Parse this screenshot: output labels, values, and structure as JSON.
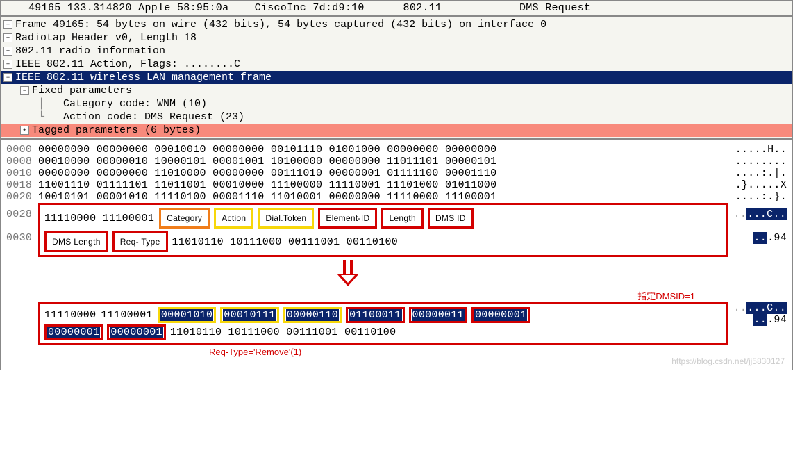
{
  "packet_list": {
    "no": "49165",
    "time": "133.314820",
    "source": "Apple 58:95:0a",
    "dest": "CiscoInc 7d:d9:10",
    "proto": "802.11",
    "info": "DMS Request"
  },
  "tree": {
    "frame": "Frame 49165: 54 bytes on wire (432 bits), 54 bytes captured (432 bits) on interface 0",
    "radiotap": "Radiotap Header v0, Length 18",
    "radio_info": "802.11 radio information",
    "ieee_action": "IEEE 802.11 Action, Flags: ........C",
    "wlan_mgmt": "IEEE 802.11 wireless LAN management frame",
    "fixed_params": "Fixed parameters",
    "category": "Category code: WNM (10)",
    "action": "Action code: DMS Request (23)",
    "tagged": "Tagged parameters (6 bytes)"
  },
  "hex": {
    "rows": [
      {
        "offset": "0000",
        "bytes": "00000000 00000000 00010010 00000000 00101110 01001000 00000000 00000000",
        "ascii": ".....H.."
      },
      {
        "offset": "0008",
        "bytes": "00010000 00000010 10000101 00001001 10100000 00000000 11011101 00000101",
        "ascii": "........"
      },
      {
        "offset": "0010",
        "bytes": "00000000 00000000 11010000 00000000 00111010 00000001 01111100 00001110",
        "ascii": "....:.|."
      },
      {
        "offset": "0018",
        "bytes": "11001110 01111101 11011001 00010000 11100000 11110001 11101000 01011000",
        "ascii": ".}.....X"
      },
      {
        "offset": "0020",
        "bytes": "10010101 00001010 11110100 00001110 11010001 00000000 11110000 11100001",
        "ascii": "....:.}."
      }
    ],
    "row0028_prefix": "11110000 11100001",
    "row0030_tail": "11010110 10111000 00111001 00110100",
    "ascii_0028": "......C..",
    "ascii_0030": "...94",
    "offset_0028": "0028",
    "offset_0030": "0030"
  },
  "field_labels": {
    "category": "Category",
    "action": "Action",
    "dial_token": "Dial.Token",
    "element_id": "Element-ID",
    "length": "Length",
    "dms_id": "DMS ID",
    "dms_length": "DMS Length",
    "req_type": "Req- Type"
  },
  "annotated": {
    "prefix1": "11110000",
    "prefix2": "11100001",
    "category": "00001010",
    "action": "00010111",
    "dial_token": "00000110",
    "element_id": "01100011",
    "length": "00000011",
    "dms_id": "00000001",
    "dms_length": "00000001",
    "req_type": "00000001",
    "tail": "11010110 10111000 00111001 00110100",
    "ascii_line1": "......C..",
    "ascii_line2": "...94"
  },
  "annotations": {
    "dmsid": "指定DMSID=1",
    "reqtype": "Req-Type='Remove'(1)"
  },
  "watermark": "https://blog.csdn.net/jj5830127"
}
